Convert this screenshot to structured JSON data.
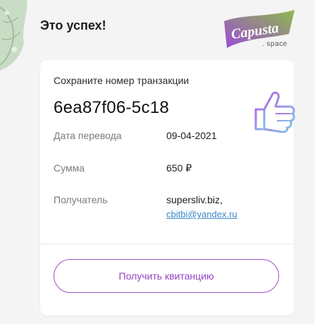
{
  "header": {
    "title": "Это успех!",
    "logo_text": "Capusta",
    "logo_sub": ". space"
  },
  "card": {
    "save_label": "Сохраните номер транзакции",
    "transaction_id": "6ea87f06-5c18",
    "rows": [
      {
        "label": "Дата перевода",
        "value": "09-04-2021"
      },
      {
        "label": "Сумма",
        "value": "650 ₽"
      },
      {
        "label": "Получатель",
        "value": "supersliv.biz,",
        "email": "cbitbi@yandex.ru"
      }
    ],
    "receipt_button": "Получить квитанцию"
  },
  "colors": {
    "accent": "#9443c2",
    "logo_gradient_start": "#9c4bd6",
    "logo_gradient_end": "#8dbb4a",
    "link": "#3a86c8"
  },
  "icons": [
    "cabbage-leaf-icon",
    "capusta-logo",
    "thumbs-up-icon"
  ]
}
